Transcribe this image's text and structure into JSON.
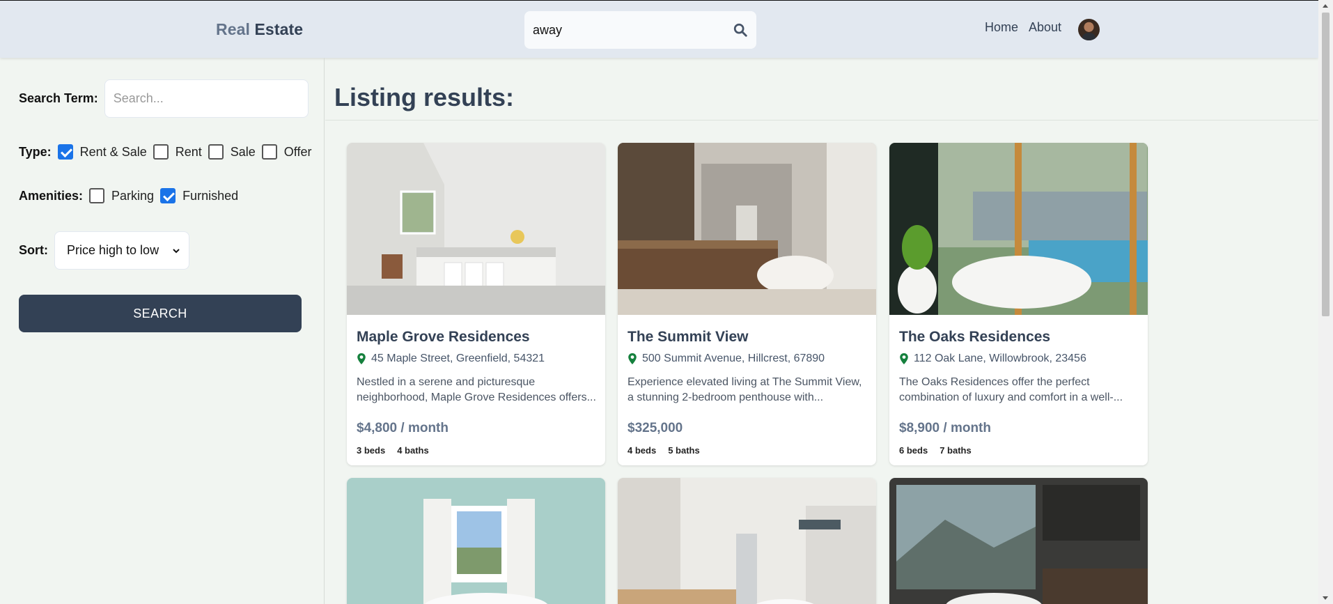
{
  "header": {
    "logo_part1": "Real",
    "logo_part2": "Estate",
    "search_value": "away",
    "nav": [
      "Home",
      "About"
    ]
  },
  "filters": {
    "search_term_label": "Search Term:",
    "search_placeholder": "Search...",
    "type_label": "Type:",
    "types": [
      {
        "label": "Rent & Sale",
        "checked": true
      },
      {
        "label": "Rent",
        "checked": false
      },
      {
        "label": "Sale",
        "checked": false
      },
      {
        "label": "Offer",
        "checked": false
      }
    ],
    "amenities_label": "Amenities:",
    "amenities": [
      {
        "label": "Parking",
        "checked": false
      },
      {
        "label": "Furnished",
        "checked": true
      }
    ],
    "sort_label": "Sort:",
    "sort_value": "Price high to low",
    "search_button": "SEARCH"
  },
  "results": {
    "title": "Listing results:",
    "listings": [
      {
        "name": "Maple Grove Residences",
        "address": "45 Maple Street, Greenfield, 54321",
        "description": "Nestled in a serene and picturesque neighborhood, Maple Grove Residences offers...",
        "price": "$4,800 / month",
        "beds": "3 beds",
        "baths": "4 baths"
      },
      {
        "name": "The Summit View",
        "address": "500 Summit Avenue, Hillcrest, 67890",
        "description": "Experience elevated living at The Summit View, a stunning 2-bedroom penthouse with...",
        "price": "$325,000",
        "beds": "4 beds",
        "baths": "5 baths"
      },
      {
        "name": "The Oaks Residences",
        "address": "112 Oak Lane, Willowbrook, 23456",
        "description": "The Oaks Residences offer the perfect combination of luxury and comfort in a well-...",
        "price": "$8,900 / month",
        "beds": "6 beds",
        "baths": "7 baths"
      }
    ]
  },
  "colors": {
    "header_bg": "#e2e8f0",
    "page_bg": "#f1f5f1",
    "primary": "#334155",
    "checkbox_on": "#1a73e8",
    "pin": "#15803d"
  }
}
